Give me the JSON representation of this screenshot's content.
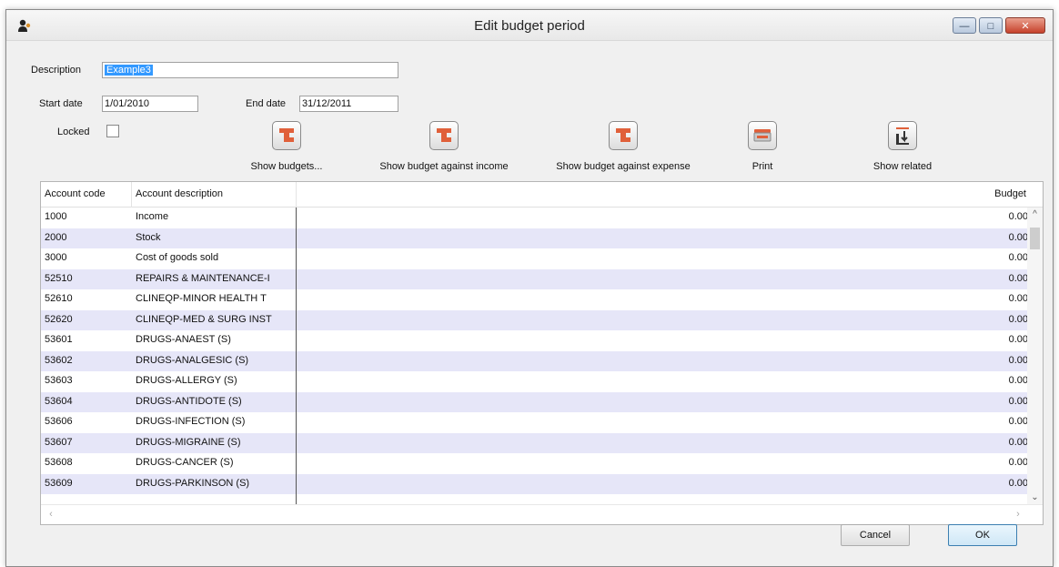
{
  "window": {
    "title": "Edit budget period"
  },
  "form": {
    "description_label": "Description",
    "description_value": "Example3",
    "start_date_label": "Start date",
    "start_date_value": "1/01/2010",
    "end_date_label": "End date",
    "end_date_value": "31/12/2011",
    "locked_label": "Locked"
  },
  "toolbar": {
    "show_budgets": "Show budgets...",
    "show_budget_income": "Show budget against income",
    "show_budget_expense": "Show budget against expense",
    "print": "Print",
    "show_related": "Show related"
  },
  "table": {
    "headers": {
      "code": "Account code",
      "description": "Account description",
      "budget": "Budget"
    },
    "rows": [
      {
        "code": "1000",
        "description": "Income",
        "budget": "0.00"
      },
      {
        "code": "2000",
        "description": "Stock",
        "budget": "0.00"
      },
      {
        "code": "3000",
        "description": "Cost of goods sold",
        "budget": "0.00"
      },
      {
        "code": "52510",
        "description": "REPAIRS & MAINTENANCE-I",
        "budget": "0.00"
      },
      {
        "code": "52610",
        "description": "CLINEQP-MINOR HEALTH T",
        "budget": "0.00"
      },
      {
        "code": "52620",
        "description": "CLINEQP-MED & SURG INST",
        "budget": "0.00"
      },
      {
        "code": "53601",
        "description": "DRUGS-ANAEST (S)",
        "budget": "0.00"
      },
      {
        "code": "53602",
        "description": "DRUGS-ANALGESIC (S)",
        "budget": "0.00"
      },
      {
        "code": "53603",
        "description": "DRUGS-ALLERGY (S)",
        "budget": "0.00"
      },
      {
        "code": "53604",
        "description": "DRUGS-ANTIDOTE (S)",
        "budget": "0.00"
      },
      {
        "code": "53606",
        "description": "DRUGS-INFECTION (S)",
        "budget": "0.00"
      },
      {
        "code": "53607",
        "description": "DRUGS-MIGRAINE (S)",
        "budget": "0.00"
      },
      {
        "code": "53608",
        "description": "DRUGS-CANCER (S)",
        "budget": "0.00"
      },
      {
        "code": "53609",
        "description": "DRUGS-PARKINSON (S)",
        "budget": "0.00"
      }
    ]
  },
  "buttons": {
    "cancel": "Cancel",
    "ok": "OK"
  },
  "icons": {
    "app": "user-icon",
    "budget": "budget-icon",
    "print": "printer-icon",
    "related": "related-icon"
  },
  "colors": {
    "selection": "#3399ff",
    "alt_row": "#e6e6f8",
    "icon_accent": "#e0603a"
  }
}
